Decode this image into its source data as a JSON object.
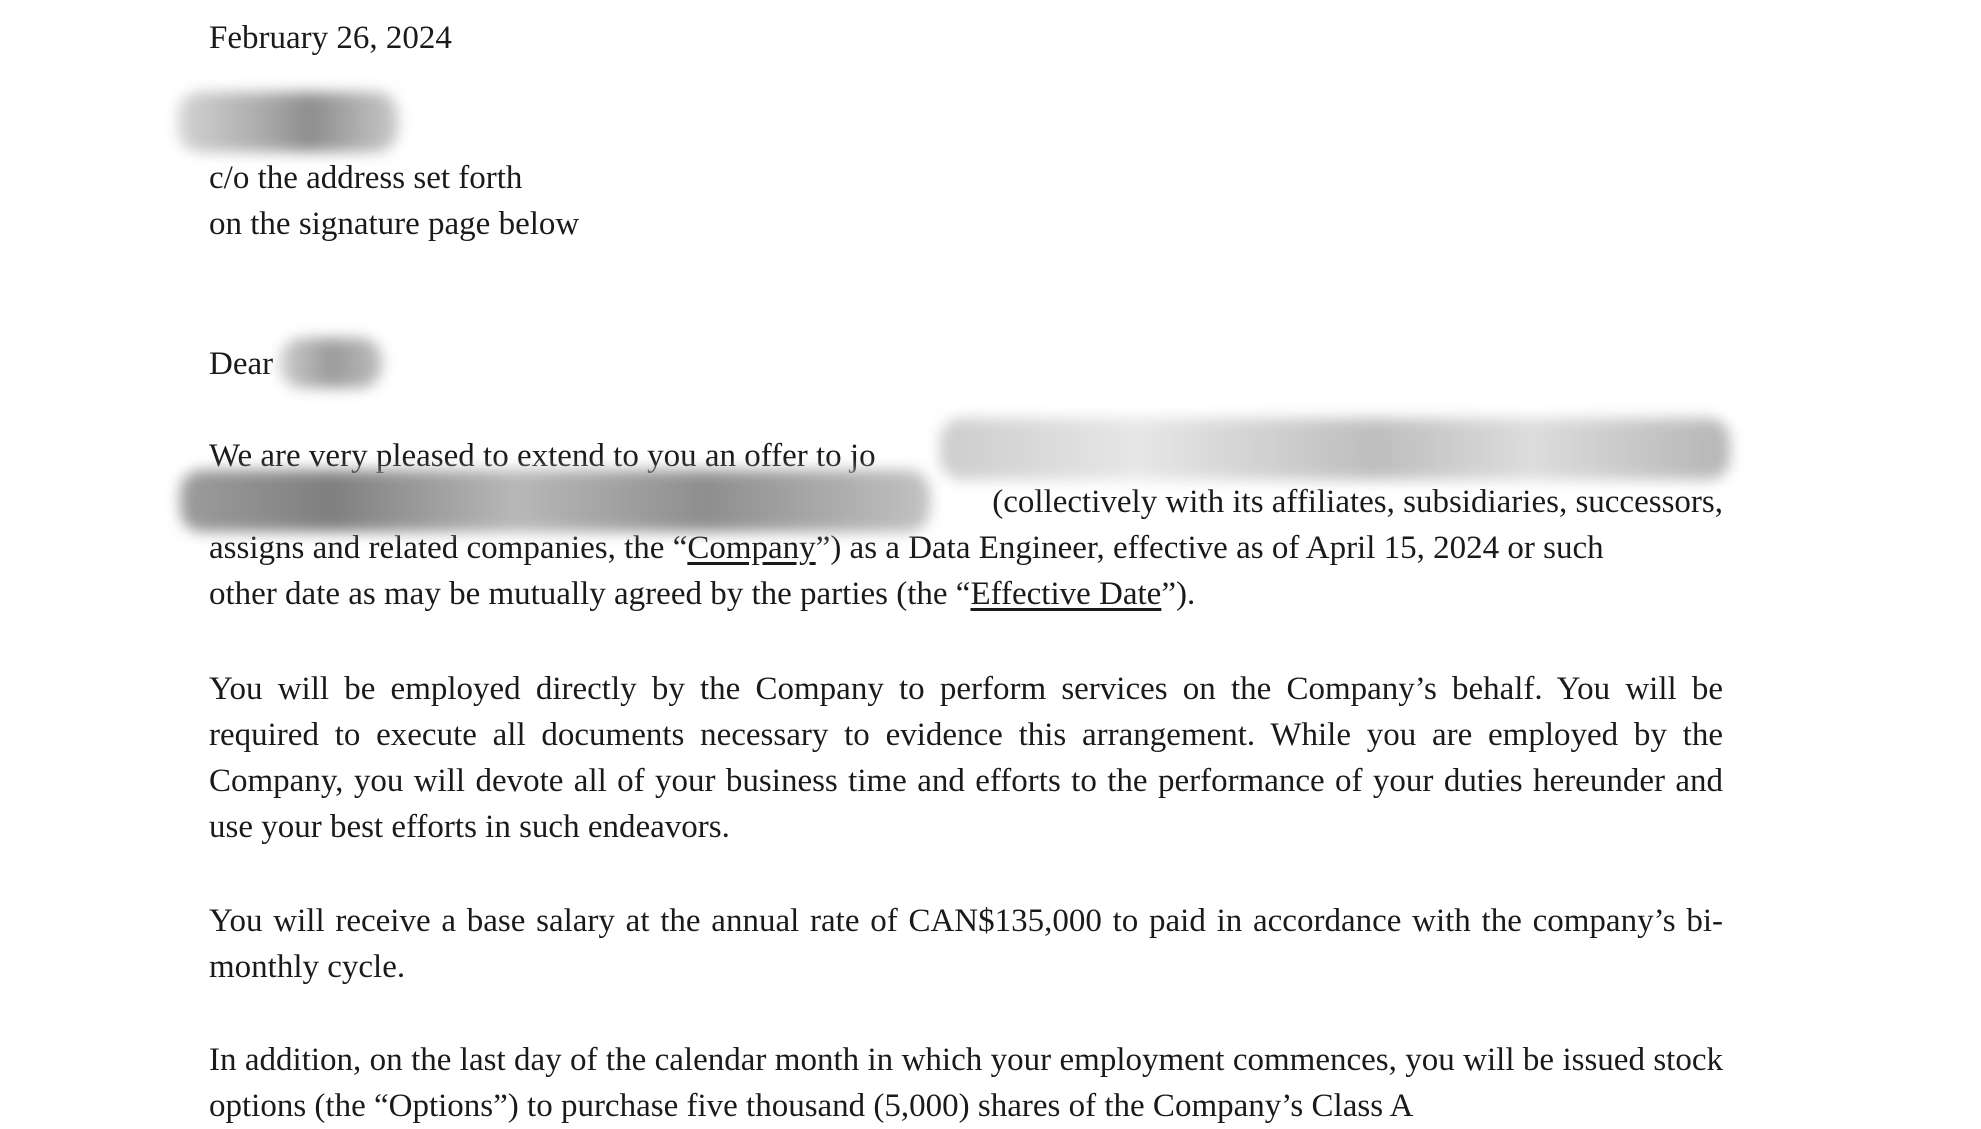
{
  "letter": {
    "date": "February 26, 2024",
    "address_line_1": "c/o the address set forth",
    "address_line_2": "on the signature page below",
    "salutation": "Dear",
    "p1": {
      "lead": "We are very pleased to extend to you an offer to jo",
      "line2_end": "(collectively with its affiliates, subsidiaries, successors,",
      "line3_a": "assigns and related companies, the “",
      "company_term": "Company",
      "line3_b": "”) as a Data Engineer, effective as of April 15, 2024 or such",
      "line4_a": "other date as may be mutually agreed by the parties (the “",
      "effective_term": "Effective Date",
      "line4_b": "”)."
    },
    "p2": "You will be employed directly by the Company to perform services on the Company’s behalf.  You will be required to execute all documents necessary to evidence this arrangement.  While you are employed by the Company, you will devote all of your business time and efforts to the performance of your duties hereunder and use your best efforts in such endeavors.",
    "p3": "You will receive a base salary at the annual rate of CAN$135,000 to paid in accordance with the company’s bi-monthly cycle.",
    "p4": "In addition, on the last day of the calendar month in which your employment commences, you will be issued stock options (the “Options”) to purchase five thousand (5,000) shares of the Company’s Class A"
  },
  "colors": {
    "text": "#1a1a1a",
    "redaction": "#8a8a8a"
  }
}
